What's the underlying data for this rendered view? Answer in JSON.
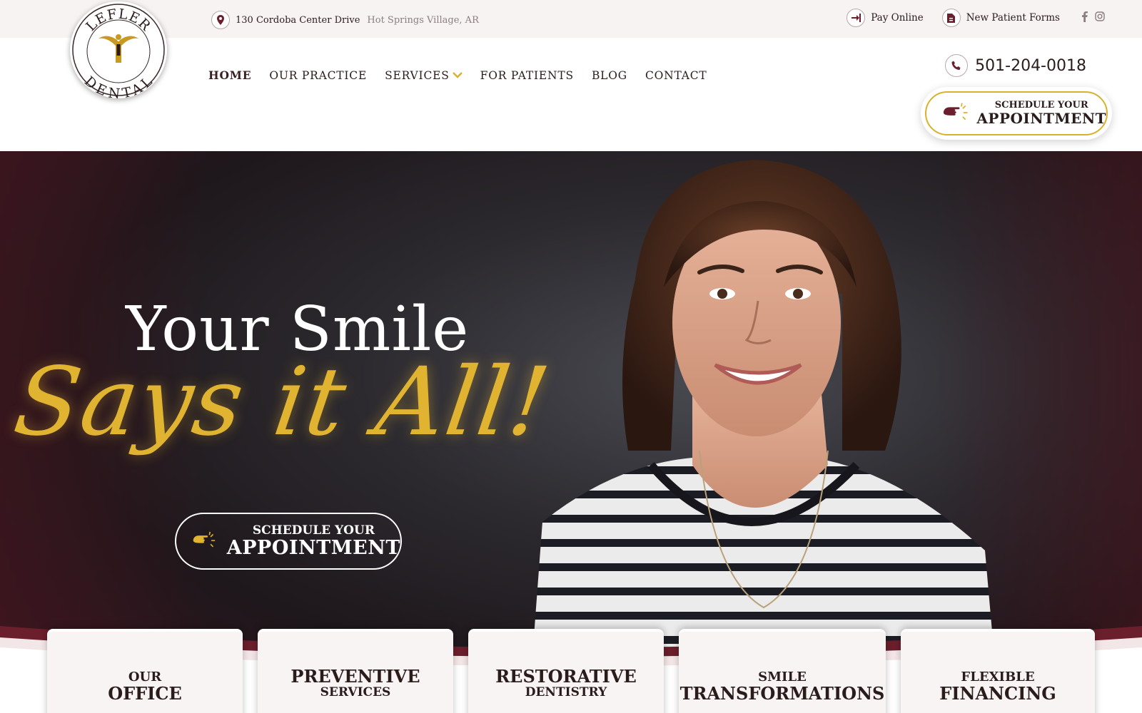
{
  "topbar": {
    "address_street": "130 Cordoba Center Drive",
    "address_city": "Hot Springs Village, AR",
    "pay_online": "Pay Online",
    "patient_forms": "New Patient Forms"
  },
  "logo": {
    "top_text": "LEFLER",
    "bottom_text": "DENTAL"
  },
  "nav": {
    "items": [
      {
        "label": "HOME"
      },
      {
        "label": "OUR PRACTICE"
      },
      {
        "label": "SERVICES"
      },
      {
        "label": "FOR PATIENTS"
      },
      {
        "label": "BLOG"
      },
      {
        "label": "CONTACT"
      }
    ]
  },
  "header": {
    "phone": "501-204-0018",
    "appt_small": "SCHEDULE YOUR",
    "appt_big": "APPOINTMENT"
  },
  "hero": {
    "headline": "Your Smile",
    "script": "Says it All!",
    "btn_small": "SCHEDULE YOUR",
    "btn_big": "APPOINTMENT"
  },
  "cards": [
    {
      "line1": "OUR",
      "line2": "OFFICE"
    },
    {
      "line1": "PREVENTIVE",
      "line2": "SERVICES"
    },
    {
      "line1": "RESTORATIVE",
      "line2": "DENTISTRY"
    },
    {
      "line1": "SMILE",
      "line2": "TRANSFORMATIONS"
    },
    {
      "line1": "FLEXIBLE",
      "line2": "FINANCING"
    }
  ],
  "colors": {
    "gold": "#e0b431",
    "maroon": "#6b1e2b",
    "dark": "#2b1c1c"
  }
}
